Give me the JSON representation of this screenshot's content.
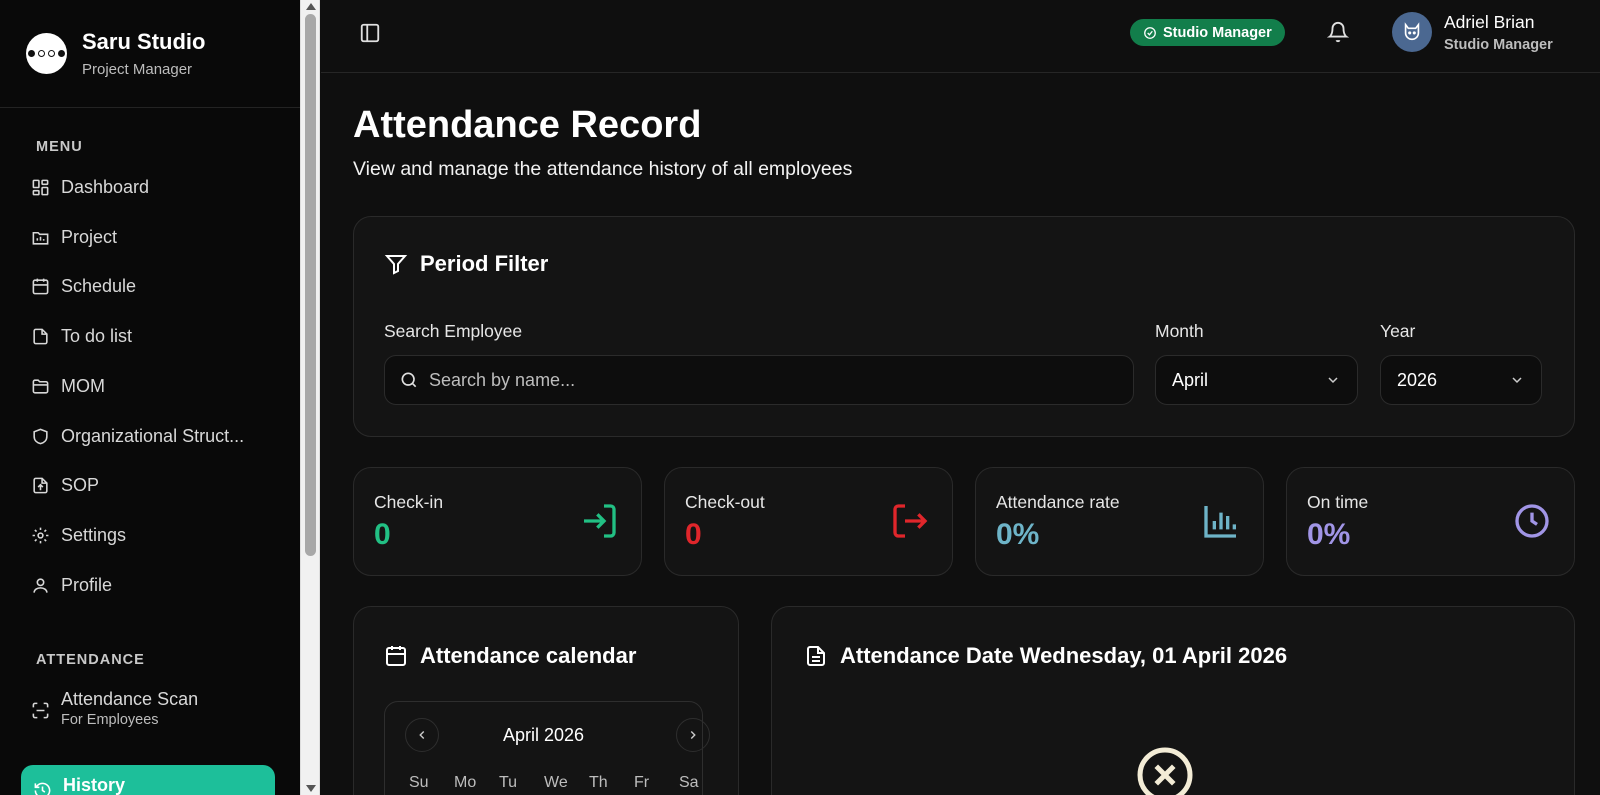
{
  "brand": {
    "title": "Saru Studio",
    "subtitle": "Project Manager"
  },
  "sidebar": {
    "menu_label": "MENU",
    "items": [
      {
        "label": "Dashboard",
        "icon": "dashboard-icon"
      },
      {
        "label": "Project",
        "icon": "project-icon"
      },
      {
        "label": "Schedule",
        "icon": "calendar-icon"
      },
      {
        "label": "To do list",
        "icon": "file-icon"
      },
      {
        "label": "MOM",
        "icon": "folder-icon"
      },
      {
        "label": "Organizational Struct...",
        "icon": "shield-icon"
      },
      {
        "label": "SOP",
        "icon": "file-upload-icon"
      },
      {
        "label": "Settings",
        "icon": "gear-icon"
      },
      {
        "label": "Profile",
        "icon": "user-icon"
      }
    ],
    "attendance_label": "ATTENDANCE",
    "attendance_items": [
      {
        "label": "Attendance Scan",
        "sub": "For Employees",
        "icon": "scan-icon"
      },
      {
        "label": "History",
        "icon": "history-icon",
        "active": true
      }
    ]
  },
  "topbar": {
    "role_badge": "Studio Manager",
    "user": {
      "name": "Adriel Brian",
      "role": "Studio Manager"
    }
  },
  "page": {
    "title": "Attendance Record",
    "subtitle": "View and manage the attendance history of all employees"
  },
  "filter": {
    "title": "Period Filter",
    "search_label": "Search Employee",
    "search_placeholder": "Search by name...",
    "month_label": "Month",
    "month_value": "April",
    "year_label": "Year",
    "year_value": "2026"
  },
  "stats": [
    {
      "label": "Check-in",
      "value": "0",
      "color": "#22c084",
      "icon": "login-icon"
    },
    {
      "label": "Check-out",
      "value": "0",
      "color": "#e0262b",
      "icon": "logout-icon"
    },
    {
      "label": "Attendance rate",
      "value": "0%",
      "color": "#6eb4c8",
      "icon": "bar-chart-icon"
    },
    {
      "label": "On time",
      "value": "0%",
      "color": "#a195e6",
      "icon": "clock-icon"
    }
  ],
  "calendar": {
    "title": "Attendance calendar",
    "month": "April 2026",
    "weekdays": [
      "Su",
      "Mo",
      "Tu",
      "We",
      "Th",
      "Fr",
      "Sa"
    ]
  },
  "detail": {
    "title": "Attendance Date Wednesday, 01 April 2026"
  }
}
